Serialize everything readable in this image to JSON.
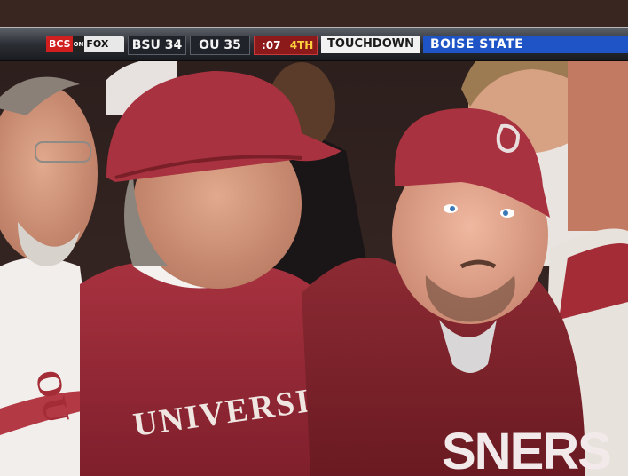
{
  "broadcast": {
    "network_logo": {
      "bcs": "BCS",
      "on": "ON",
      "fox": "FOX"
    },
    "score": {
      "away_team": "BSU",
      "away_score": "34",
      "home_team": "OU",
      "home_score": "35"
    },
    "game_clock": ":07",
    "quarter": "4TH",
    "event": "TOUCHDOWN",
    "scoring_team": "BOISE STATE"
  },
  "scene": {
    "jersey_text_left_fan": "UNIVERSITY",
    "jersey_text_right_fan": "SNERS",
    "shirt_logo_far_left": "OU"
  },
  "colors": {
    "crimson": "#9b2335",
    "banner_blue": "#1f54c7",
    "clock_red": "#8c1a1a",
    "quarter_yellow": "#ffcf3c"
  }
}
